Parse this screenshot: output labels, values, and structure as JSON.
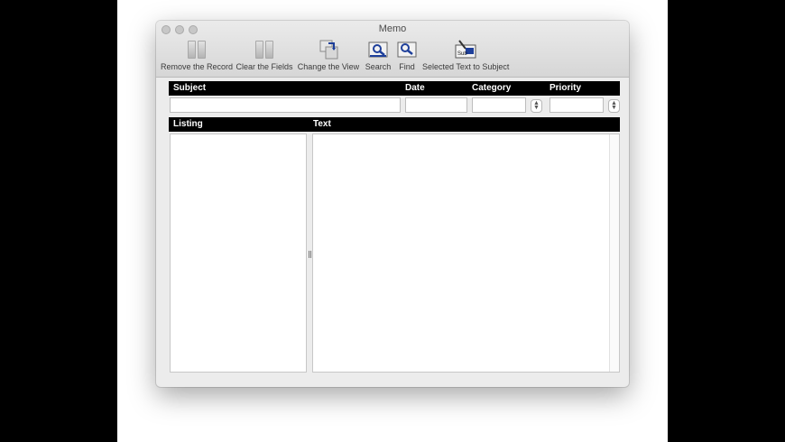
{
  "window": {
    "title": "Memo"
  },
  "toolbar": {
    "items": [
      {
        "label": "Remove the Record",
        "icon": "pause-icon"
      },
      {
        "label": "Clear the Fields",
        "icon": "pause-icon"
      },
      {
        "label": "Change the View",
        "icon": "change-view-icon"
      },
      {
        "label": "Search",
        "icon": "search-icon"
      },
      {
        "label": "Find",
        "icon": "find-icon"
      },
      {
        "label": "Selected Text to Subject",
        "icon": "text-to-subject-icon"
      }
    ],
    "subject_icon_text": "Sub"
  },
  "form": {
    "subject_label": "Subject",
    "date_label": "Date",
    "category_label": "Category",
    "priority_label": "Priority",
    "subject_value": "",
    "date_value": "",
    "category_value": "",
    "priority_value": ""
  },
  "panes": {
    "listing_label": "Listing",
    "text_label": "Text"
  },
  "colors": {
    "header_bar": "#000000",
    "accent_blue": "#1e3f9a"
  }
}
